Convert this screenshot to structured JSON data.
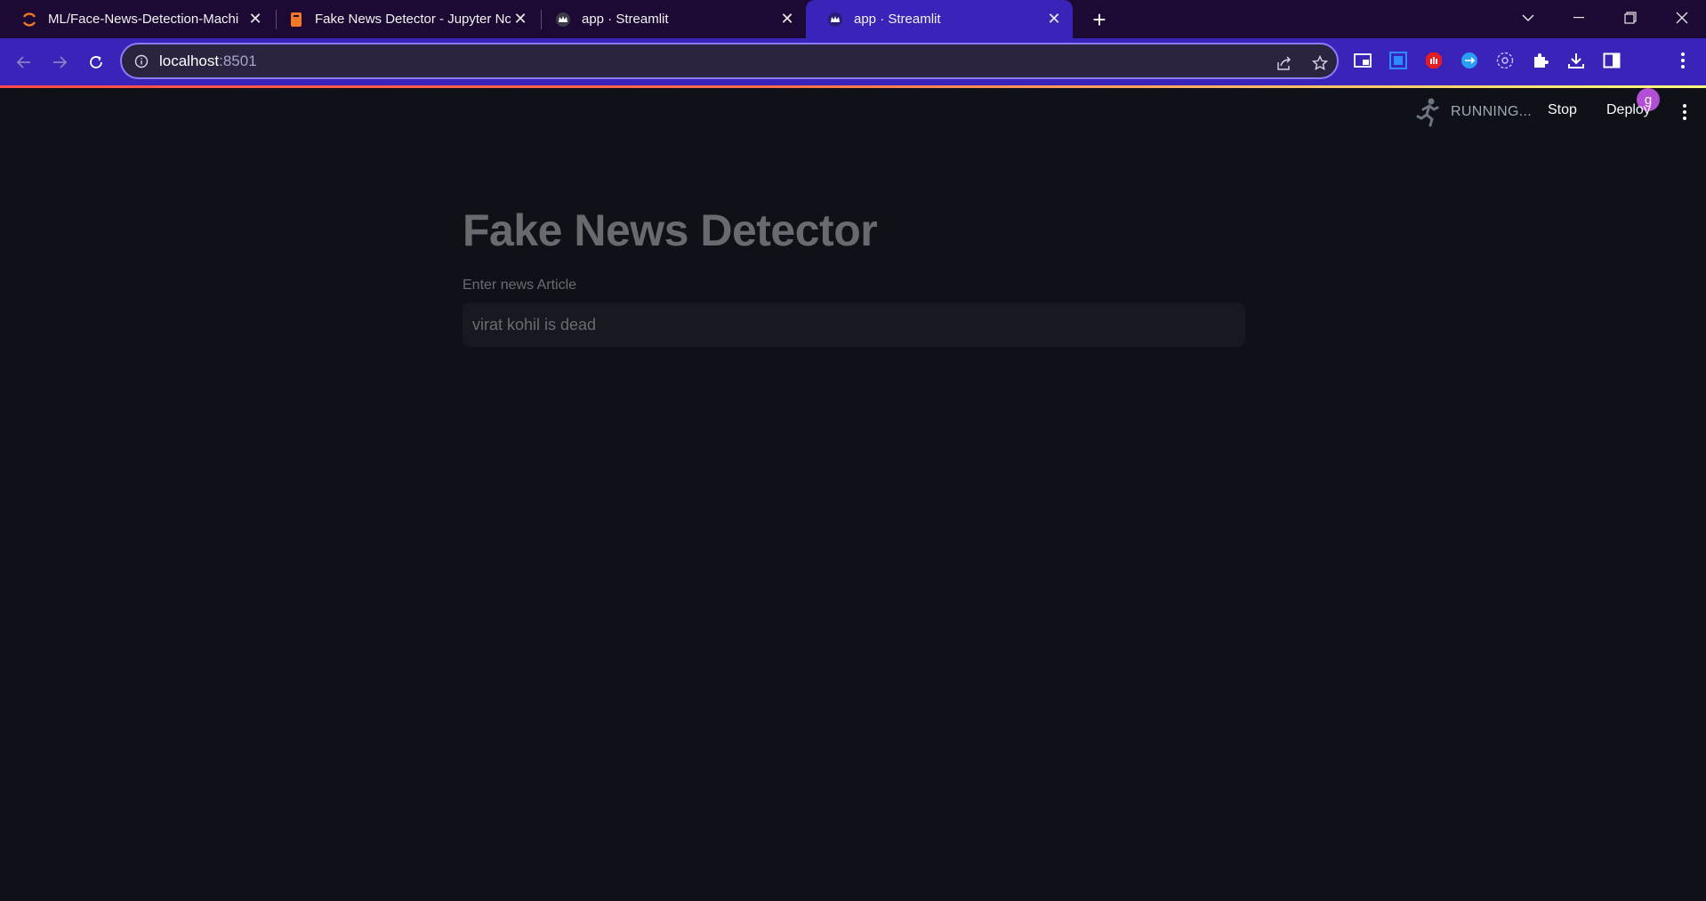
{
  "browser": {
    "tabs": [
      {
        "title": "ML/Face-News-Detection-Machi",
        "icon": "jupyter-icon",
        "active": false
      },
      {
        "title": "Fake News Detector - Jupyter Nc",
        "icon": "notebook-icon",
        "active": false
      },
      {
        "title": "app · Streamlit",
        "icon": "streamlit-crown-icon",
        "active": false
      },
      {
        "title": "app · Streamlit",
        "icon": "streamlit-crown-icon",
        "active": true
      }
    ],
    "url_host": "localhost",
    "url_port": ":8501",
    "profile_initial": "g"
  },
  "streamlit_header": {
    "status": "RUNNING...",
    "stop_label": "Stop",
    "deploy_label": "Deploy"
  },
  "main": {
    "title": "Fake News Detector",
    "input_label": "Enter news Article",
    "input_value": "virat kohil is dead"
  },
  "colors": {
    "tabstrip": "#1c0a35",
    "active_tab": "#3a23b8",
    "app_background": "#0e1117",
    "input_background": "#262730"
  }
}
